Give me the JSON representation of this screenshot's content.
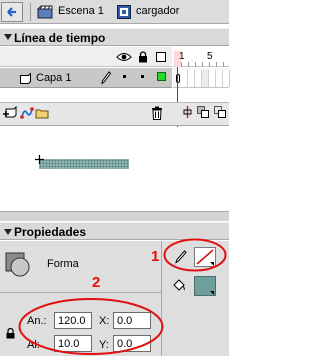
{
  "scene_bar": {
    "scene_label": "Escena 1",
    "symbol_label": "cargador"
  },
  "timeline": {
    "title": "Línea de tiempo",
    "frame_numbers": [
      "1",
      "5"
    ],
    "layer": {
      "name": "Capa 1",
      "color": "#27d727"
    }
  },
  "stage": {
    "shape_fill": "#8fb5b3"
  },
  "properties": {
    "title": "Propiedades",
    "shape_type": "Forma",
    "width_label": "An.:",
    "width_value": "120.0",
    "height_label": "Al:",
    "height_value": "10.0",
    "x_label": "X:",
    "x_value": "0.0",
    "y_label": "Y:",
    "y_value": "0.0",
    "stroke_color": "#ffffff",
    "fill_color": "#6e9f9c"
  },
  "annotations": {
    "label_1": "1",
    "label_2": "2",
    "color": "#e01010"
  }
}
